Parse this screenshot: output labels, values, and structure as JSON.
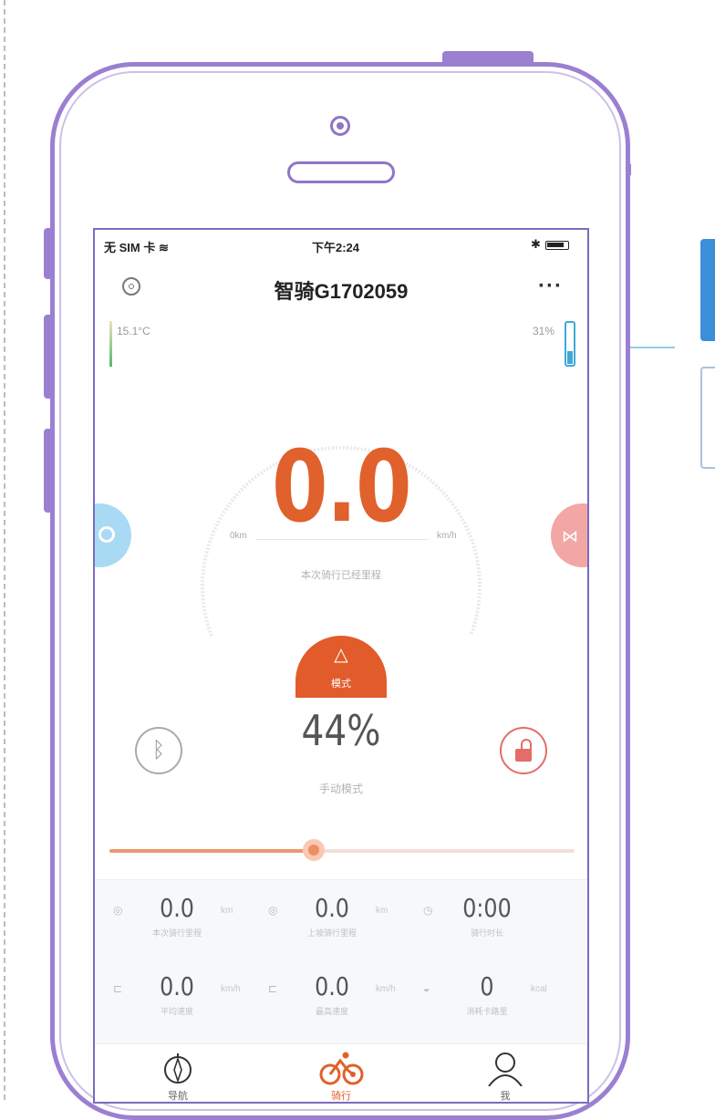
{
  "status_bar": {
    "carrier": "无 SIM 卡",
    "time": "下午2:24",
    "bluetooth": "✱"
  },
  "nav": {
    "title": "智骑G1702059",
    "more": "···"
  },
  "temperature": "15.1°C",
  "battery_percent_text": "31%",
  "battery_level": 0.31,
  "speed": "0.0",
  "gauge": {
    "min_label": "0km",
    "max_label": "km/h",
    "subtitle": "本次骑行已经里程"
  },
  "mode_button": {
    "label": "模式"
  },
  "assist_percent": "44%",
  "mode_name": "手动模式",
  "slider_value": 0.44,
  "stats": [
    {
      "value": "0.0",
      "label": "本次骑行里程",
      "unit": "km",
      "icon": "distance-icon"
    },
    {
      "value": "0.0",
      "label": "上坡骑行里程",
      "unit": "km",
      "icon": "uphill-icon"
    },
    {
      "value": "0:00",
      "label": "骑行时长",
      "unit": "",
      "icon": "clock-icon"
    },
    {
      "value": "0.0",
      "label": "平均速度",
      "unit": "km/h",
      "icon": "avg-speed-icon"
    },
    {
      "value": "0.0",
      "label": "最高速度",
      "unit": "km/h",
      "icon": "max-speed-icon"
    },
    {
      "value": "0",
      "label": "消耗卡路里",
      "unit": "kcal",
      "icon": "calorie-icon"
    }
  ],
  "tabs": [
    {
      "label": "导航",
      "icon": "compass-icon"
    },
    {
      "label": "骑行",
      "icon": "bike-icon",
      "active": true
    },
    {
      "label": "我",
      "icon": "user-icon"
    }
  ],
  "colors": {
    "accent": "#e0612b",
    "frame": "#9b7fd1",
    "battery": "#3fa9d6"
  }
}
